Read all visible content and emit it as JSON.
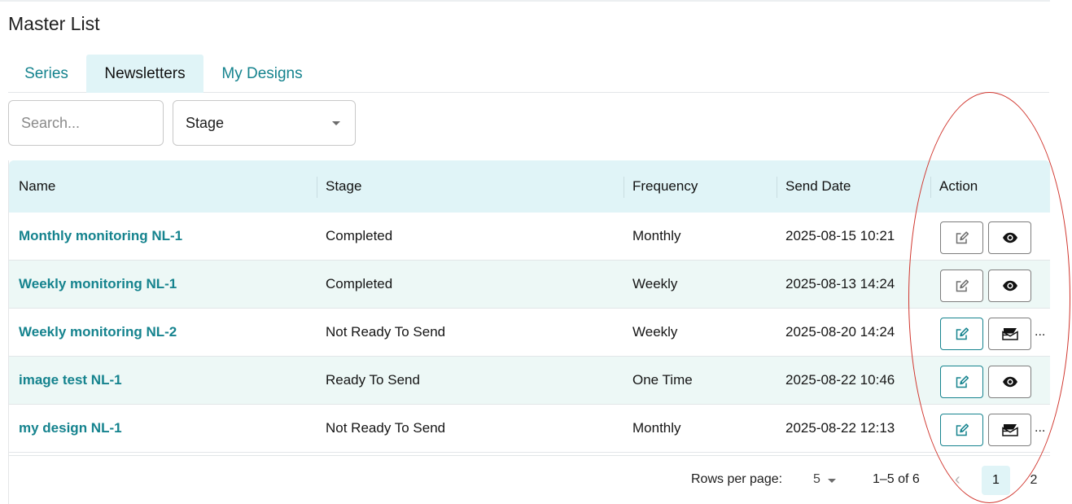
{
  "page": {
    "title": "Master List"
  },
  "tabs": [
    {
      "label": "Series"
    },
    {
      "label": "Newsletters"
    },
    {
      "label": "My Designs"
    }
  ],
  "filters": {
    "search_placeholder": "Search...",
    "stage_label": "Stage",
    "stage_icon": "chevron-down-icon"
  },
  "table": {
    "columns": [
      "Name",
      "Stage",
      "Frequency",
      "Send Date",
      "Action"
    ],
    "rows": [
      {
        "name": "Monthly monitoring NL-1",
        "stage": "Completed",
        "frequency": "Monthly",
        "send_date": "2025-08-15 10:21",
        "edit_enabled": false,
        "second_action": "view-icon",
        "more": ""
      },
      {
        "name": "Weekly monitoring NL-1",
        "stage": "Completed",
        "frequency": "Weekly",
        "send_date": "2025-08-13 14:24",
        "edit_enabled": false,
        "second_action": "view-icon",
        "more": ""
      },
      {
        "name": "Weekly monitoring NL-2",
        "stage": "Not Ready To Send",
        "frequency": "Weekly",
        "send_date": "2025-08-20 14:24",
        "edit_enabled": true,
        "second_action": "send-icon",
        "more": "..."
      },
      {
        "name": "image test NL-1",
        "stage": "Ready To Send",
        "frequency": "One Time",
        "send_date": "2025-08-22 10:46",
        "edit_enabled": true,
        "second_action": "view-icon",
        "more": ""
      },
      {
        "name": "my design NL-1",
        "stage": "Not Ready To Send",
        "frequency": "Monthly",
        "send_date": "2025-08-22 12:13",
        "edit_enabled": true,
        "second_action": "send-icon",
        "more": "..."
      }
    ]
  },
  "pagination": {
    "rows_per_page_label": "Rows per page:",
    "rows_per_page_value": "5",
    "range_text": "1–5 of 6",
    "pages": [
      "1",
      "2"
    ],
    "current_page": "1"
  },
  "colors": {
    "accent": "#15838e",
    "header_bg": "#e0f4f7",
    "alt_row_bg": "#edf8f6",
    "annotation": "#d0342c"
  }
}
